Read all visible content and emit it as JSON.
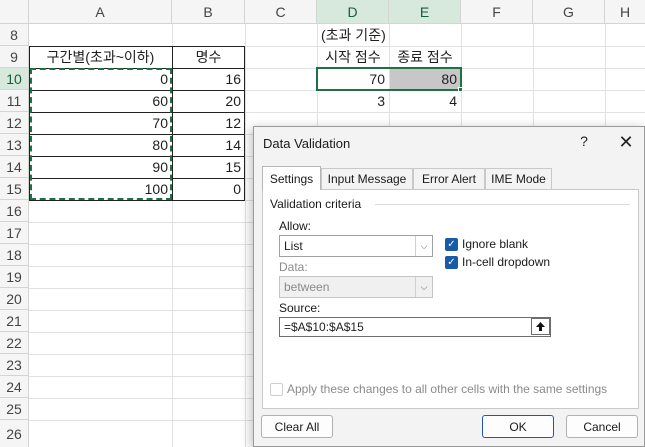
{
  "sheet": {
    "columns": [
      "A",
      "B",
      "C",
      "D",
      "E",
      "F",
      "G",
      "H"
    ],
    "rows": [
      "8",
      "9",
      "10",
      "11",
      "12",
      "13",
      "14",
      "15",
      "16",
      "17",
      "18",
      "19",
      "20",
      "21",
      "22",
      "23",
      "24",
      "25",
      "26"
    ],
    "headers": {
      "range_header": "구간별(초과~이하)",
      "count_header": "명수",
      "note": "(초과 기준)",
      "start_header": "시작 점수",
      "end_header": "종료 점수"
    },
    "range_values": [
      "0",
      "60",
      "70",
      "80",
      "90",
      "100"
    ],
    "count_values": [
      "16",
      "20",
      "12",
      "14",
      "15",
      "0"
    ],
    "start_score": "70",
    "end_score": "80",
    "start_count": "3",
    "end_count": "4"
  },
  "dialog": {
    "title": "Data Validation",
    "help": "?",
    "close": "✕",
    "tabs": [
      "Settings",
      "Input Message",
      "Error Alert",
      "IME Mode"
    ],
    "section_title": "Validation criteria",
    "allow_label": "Allow:",
    "allow_value": "List",
    "ignore_blank_label": "Ignore blank",
    "in_cell_dropdown_label": "In-cell dropdown",
    "data_label": "Data:",
    "data_value": "between",
    "source_label": "Source:",
    "source_value": "=$A$10:$A$15",
    "apply_label": "Apply these changes to all other cells with the same settings",
    "clear_all": "Clear All",
    "ok": "OK",
    "cancel": "Cancel"
  }
}
